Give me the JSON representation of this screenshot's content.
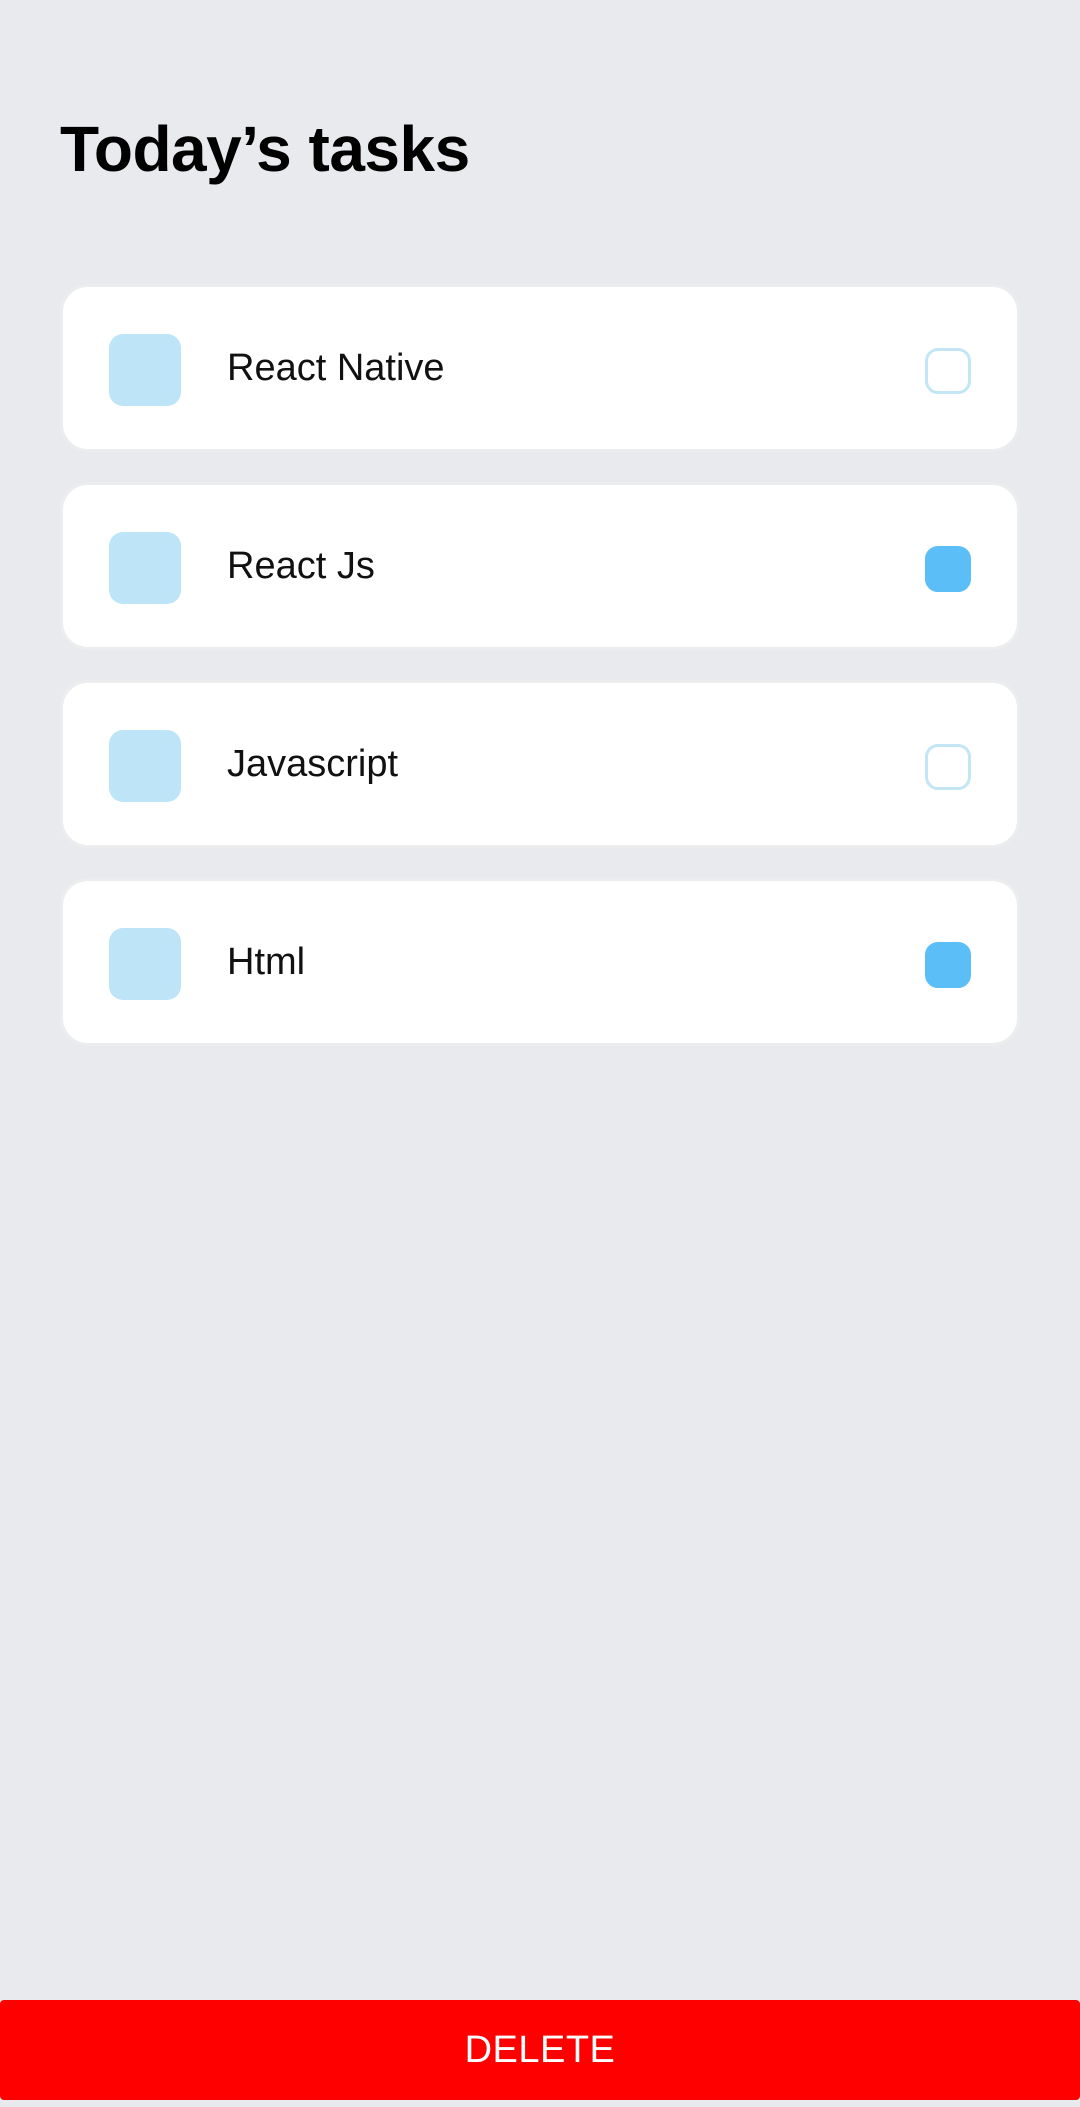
{
  "header": {
    "title": "Today’s tasks"
  },
  "tasks": [
    {
      "label": "React Native",
      "checked": false
    },
    {
      "label": "React Js",
      "checked": true
    },
    {
      "label": "Javascript",
      "checked": false
    },
    {
      "label": "Html",
      "checked": true
    }
  ],
  "footer": {
    "delete_label": "DELETE"
  },
  "colors": {
    "background": "#E8EAED",
    "card": "#FFFFFF",
    "task_square": "#BEE4F8",
    "checkbox_border": "#C3E6F5",
    "checkbox_checked": "#5BBEF6",
    "delete_button": "#FF0000",
    "delete_text": "#FFFFFF"
  }
}
